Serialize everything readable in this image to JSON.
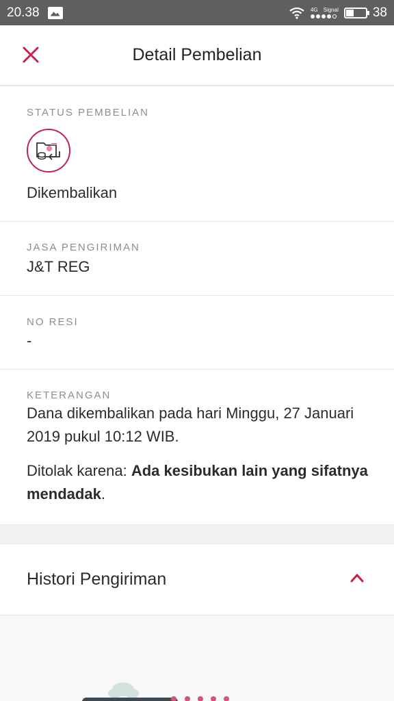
{
  "status_bar": {
    "time": "20.38",
    "network": "4G",
    "signal_label": "Signal",
    "battery": "38"
  },
  "header": {
    "title": "Detail Pembelian"
  },
  "status": {
    "label": "STATUS PEMBELIAN",
    "value": "Dikembalikan"
  },
  "courier": {
    "label": "JASA PENGIRIMAN",
    "value": "J&T REG"
  },
  "resi": {
    "label": "NO RESI",
    "value": "-"
  },
  "keterangan": {
    "label": "KETERANGAN",
    "line1": "Dana dikembalikan pada hari Minggu, 27 Januari 2019 pukul 10:12 WIB.",
    "reason_prefix": "Ditolak karena: ",
    "reason": "Ada kesibukan lain yang sifatnya mendadak",
    "reason_suffix": "."
  },
  "histori": {
    "title": "Histori Pengiriman"
  },
  "colors": {
    "accent": "#c4204a",
    "statusbar": "#5f5f5f"
  }
}
